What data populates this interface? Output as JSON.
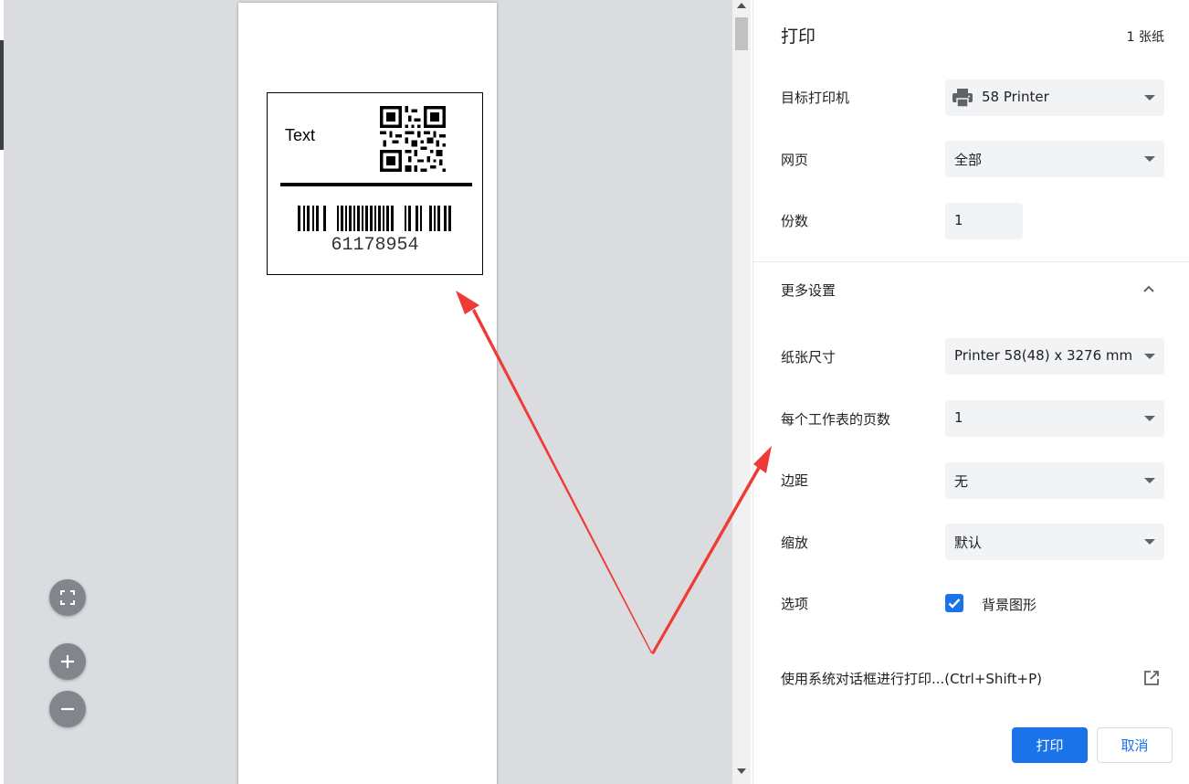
{
  "preview": {
    "label_text": "Text",
    "barcode_number": "61178954"
  },
  "panel": {
    "title": "打印",
    "sheet_count": "1 张纸",
    "destination": {
      "label": "目标打印机",
      "value": "58 Printer",
      "icon": "printer-icon"
    },
    "pages": {
      "label": "网页",
      "value": "全部"
    },
    "copies": {
      "label": "份数",
      "value": "1"
    },
    "more_settings": "更多设置",
    "paper_size": {
      "label": "纸张尺寸",
      "value": "Printer 58(48) x 3276 mm"
    },
    "pages_per_sheet": {
      "label": "每个工作表的页数",
      "value": "1"
    },
    "margins": {
      "label": "边距",
      "value": "无"
    },
    "scale": {
      "label": "缩放",
      "value": "默认"
    },
    "options": {
      "label": "选项",
      "background_graphics": "背景图形",
      "checked": true
    },
    "system_dialog": "使用系统对话框进行打印...(Ctrl+Shift+P)",
    "print_button": "打印",
    "cancel_button": "取消"
  },
  "colors": {
    "accent": "#1a73e8",
    "arrow": "#ef3b36",
    "preview_bg": "#dadce0"
  }
}
